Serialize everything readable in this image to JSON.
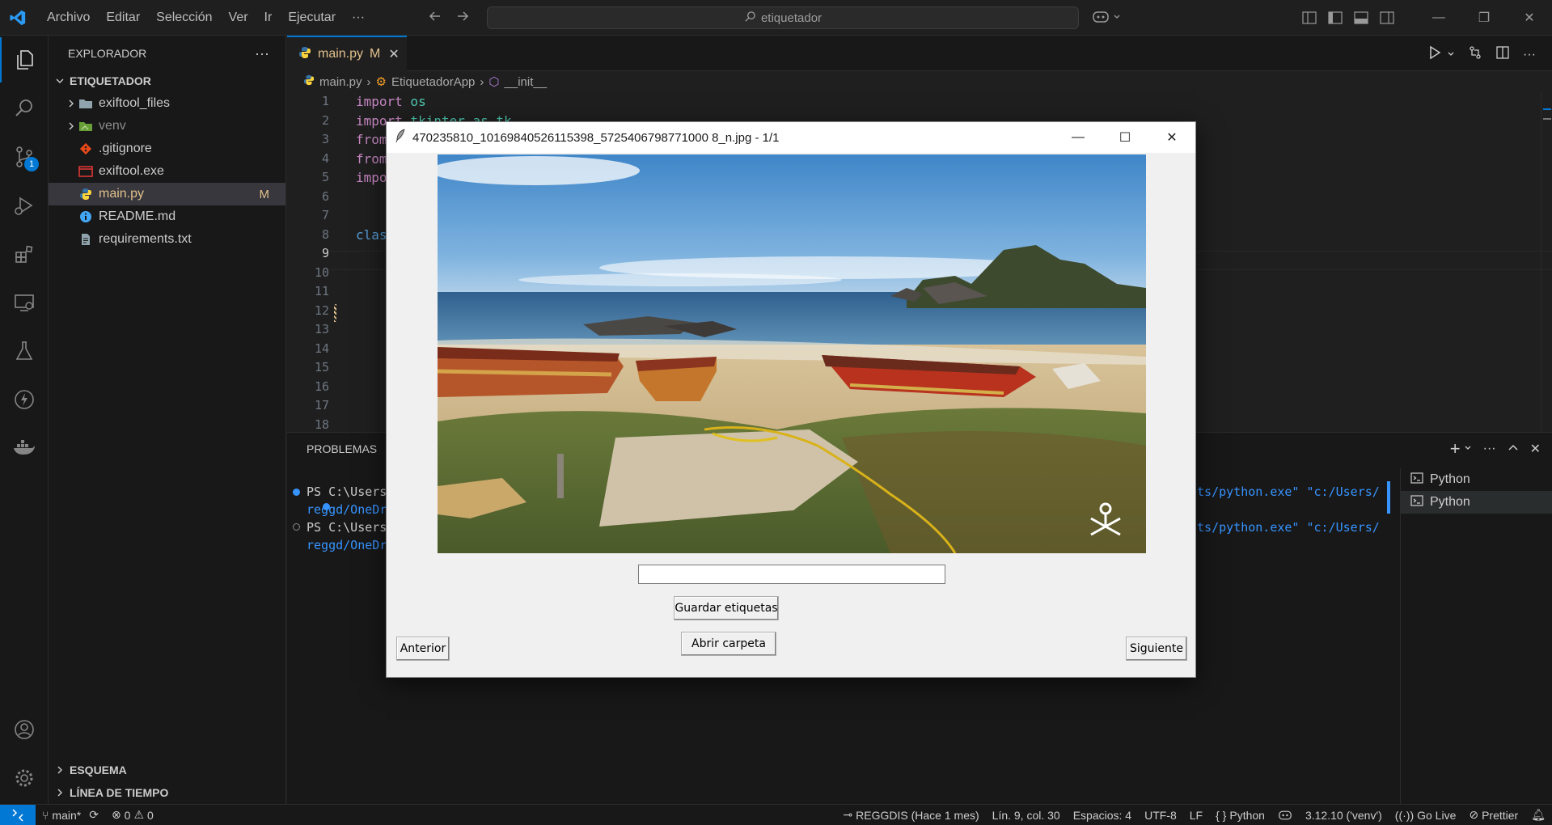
{
  "titlebar": {
    "menu": [
      "Archivo",
      "Editar",
      "Selección",
      "Ver",
      "Ir",
      "Ejecutar",
      "···"
    ],
    "search_placeholder": "etiquetador"
  },
  "activitybar": {
    "items": [
      "explorer-icon",
      "search-icon",
      "source-control-icon",
      "run-debug-icon",
      "extensions-icon",
      "remote-explorer-icon",
      "testing-icon",
      "lightning-icon",
      "docker-icon"
    ],
    "source_control_badge": "1"
  },
  "sidebar": {
    "title": "EXPLORADOR",
    "more": "···",
    "project": "ETIQUETADOR",
    "items": [
      {
        "label": "exiftool_files",
        "type": "folder",
        "color": "#90a4ae"
      },
      {
        "label": "venv",
        "type": "folder",
        "color": "#8bc34a"
      },
      {
        "label": ".gitignore",
        "type": "git",
        "color": "#e64a19"
      },
      {
        "label": "exiftool.exe",
        "type": "exe",
        "color": "#e53935"
      },
      {
        "label": "main.py",
        "type": "python",
        "modified": "M"
      },
      {
        "label": "README.md",
        "type": "info",
        "color": "#42a5f5"
      },
      {
        "label": "requirements.txt",
        "type": "text",
        "color": "#90a4ae"
      }
    ],
    "outline": "ESQUEMA",
    "timeline": "LÍNEA DE TIEMPO"
  },
  "editor": {
    "tab_label": "main.py",
    "tab_modified": "M",
    "breadcrumb": [
      "main.py",
      "EtiquetadorApp",
      "__init__"
    ],
    "line_numbers": [
      "1",
      "2",
      "3",
      "4",
      "5",
      "6",
      "7",
      "8",
      "9",
      "10",
      "11",
      "12",
      "13",
      "14",
      "15",
      "16",
      "17",
      "18"
    ],
    "code": [
      {
        "kw": "import",
        "rest": " os"
      },
      {
        "kw": "import",
        "rest": " tkinter as tk"
      },
      {
        "kw": "from",
        "rest": ""
      },
      {
        "kw": "from",
        "rest": ""
      },
      {
        "kw": "impo",
        "rest": ""
      },
      {
        "kw": "",
        "rest": ""
      },
      {
        "kw": "",
        "rest": ""
      },
      {
        "kw": "clas",
        "rest": ""
      }
    ]
  },
  "panel": {
    "tab": "PROBLEMAS",
    "term_lines": [
      {
        "left": "PS C:\\Users",
        "right": "pts/python.exe\" \"c:/Users/"
      },
      {
        "left": "reggd/OneDr",
        "right": ""
      },
      {
        "left": "PS C:\\Users",
        "right": "pts/python.exe\" \"c:/Users/"
      },
      {
        "left": "reggd/OneDr",
        "right": ""
      }
    ],
    "terminals": [
      "Python",
      "Python"
    ]
  },
  "statusbar": {
    "branch": "main*",
    "errors": "0",
    "warnings": "0",
    "author": "REGGDIS (Hace 1 mes)",
    "position": "Lín. 9, col. 30",
    "spaces": "Espacios: 4",
    "encoding": "UTF-8",
    "eol": "LF",
    "language": "Python",
    "interpreter": "3.12.10 ('venv')",
    "golive": "Go Live",
    "prettier": "Prettier"
  },
  "dialog": {
    "title": "470235810_10169840526115398_5725406798771000 8_n.jpg - 1/1",
    "photo_alt": "beach with boats",
    "entry_value": "",
    "save_button": "Guardar etiquetas",
    "open_button": "Abrir carpeta",
    "prev_button": "Anterior",
    "next_button": "Siguiente"
  }
}
